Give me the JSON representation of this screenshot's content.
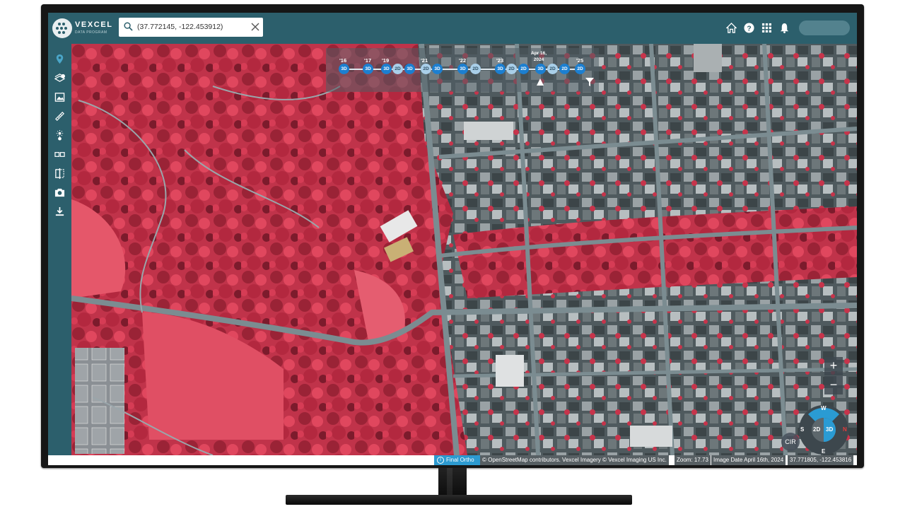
{
  "app": {
    "brand": "VEXCEL",
    "brand_sub": "DATA PROGRAM",
    "accent_color": "#2c5f6c",
    "timeline_color": "#1c7fd0"
  },
  "search": {
    "value": "(37.772145, -122.453912)",
    "icon": "search-icon",
    "clear_icon": "close-icon"
  },
  "topbar_icons": [
    "home-icon",
    "help-icon",
    "apps-grid-icon",
    "bell-icon"
  ],
  "sidebar_icons": [
    "location-pin-icon",
    "layers-add-icon",
    "image-icon",
    "ruler-icon",
    "brightness-icon",
    "compare-icon",
    "split-view-icon",
    "camera-icon",
    "download-icon"
  ],
  "timeline": {
    "years": [
      "'16",
      "'17",
      "'19",
      "'21",
      "'22",
      "'23",
      "'25"
    ],
    "selected_date_line1": "Apr 16,",
    "selected_date_line2": "2024",
    "nodes": [
      "3D",
      "3D",
      "3D",
      "2D",
      "3D",
      "2D",
      "3D",
      "3D",
      "2D",
      "3D",
      "2D",
      "2D",
      "3D",
      "2D",
      "2D",
      "2D"
    ],
    "filter_icon": "filter-icon",
    "marker_icon": "selected-marker-icon"
  },
  "map_controls": {
    "zoom_in": "+",
    "zoom_out": "−",
    "cir_label": "CIR",
    "compass": {
      "north": "W",
      "east": "N",
      "south": "E",
      "west": "S",
      "mode_2d": "2D",
      "mode_3d": "3D"
    }
  },
  "statusbar": {
    "layer": "Final Ortho",
    "attribution": "© OpenStreetMap contributors. Vexcel Imagery © Vexcel Imaging US Inc.",
    "zoom": "Zoom: 17.73",
    "image_date": "Image Date April 16th, 2024",
    "coords": "37.771805, -122.453816"
  }
}
